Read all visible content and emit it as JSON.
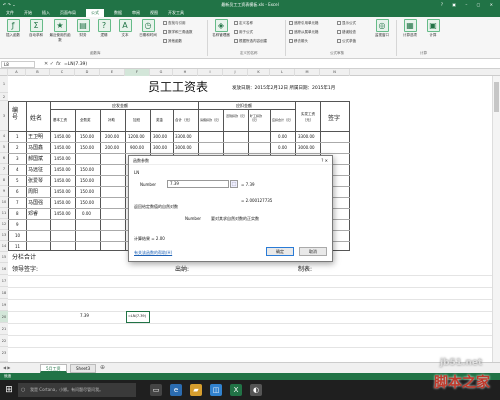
{
  "window": {
    "title": "最新员工工资表模板.xls - Excel",
    "quick_access": "↶ ↷ ⌄",
    "controls": "? ▣ – ▢ ✕"
  },
  "ribbon_tabs": [
    "文件",
    "开始",
    "插入",
    "页面布局",
    "公式",
    "数据",
    "审阅",
    "视图",
    "开发工具"
  ],
  "active_tab": "公式",
  "ribbon": {
    "insert_function": "插入函数",
    "autosum": "自动求和",
    "recent": "最近使用的函数",
    "financial": "财务",
    "logical": "逻辑",
    "text": "文本",
    "datetime": "日期和时间",
    "lookup": "查找与引用",
    "math": "数学和三角函数",
    "more": "其他函数",
    "name_manager": "名称管理器",
    "define_name": "定义名称",
    "use_in_formula": "用于公式",
    "create_from_sel": "根据所选内容创建",
    "trace_precedents": "追踪引用单元格",
    "trace_dependents": "追踪从属单元格",
    "remove_arrows": "移去箭头",
    "show_formulas": "显示公式",
    "error_check": "错误检查",
    "eval_formula": "公式求值",
    "watch": "监视窗口",
    "calc_options": "计算选项",
    "calc_now": "计算",
    "group_library": "函数库",
    "group_names": "定义的名称",
    "group_audit": "公式审核",
    "group_calc": "计算"
  },
  "formula_bar": {
    "name_box": "L8",
    "fx": "fx",
    "formula": "=LN(7.39)"
  },
  "columns": [
    "A",
    "B",
    "C",
    "D",
    "E",
    "F",
    "G",
    "H",
    "I",
    "J",
    "K",
    "L",
    "M",
    "N"
  ],
  "rows": [
    "1",
    "2",
    "3",
    "4",
    "5",
    "6",
    "7",
    "8",
    "9",
    "10",
    "11",
    "12",
    "13",
    "14",
    "15",
    "16",
    "17",
    "18",
    "19",
    "20",
    "21",
    "22",
    "23"
  ],
  "sheet": {
    "title": "员工工资表",
    "pay_date": "发放日期：2015年2月12日 所属日期：2015年1月",
    "hdr_no": "编号",
    "hdr_name": "姓名",
    "hdr_should": "应发金额",
    "hdr_deduct": "应扣金额",
    "hdr_base": "基本工资",
    "hdr_allow": "全勤奖",
    "hdr_sub": "补助",
    "hdr_ot": "加班",
    "hdr_bonus": "奖金",
    "hdr_total": "合计（元）",
    "hdr_ded1": "请假扣款（元）",
    "hdr_ded2": "迟到扣款（元）",
    "hdr_ded3": "旷工扣款（元）",
    "hdr_ded_total": "应扣合计（元）",
    "hdr_actual": "实发工资（元）",
    "hdr_sign": "签字",
    "employees": [
      {
        "no": "1",
        "name": "王卫明",
        "base": "1450.00",
        "allow": "150.00",
        "sub": "200.00",
        "ot": "1200.00",
        "bonus": "300.00",
        "total": "3300.00",
        "ded": "0.00",
        "actual": "3300.00"
      },
      {
        "no": "2",
        "name": "马国鑫",
        "base": "1450.00",
        "allow": "150.00",
        "sub": "200.00",
        "ot": "900.00",
        "bonus": "300.00",
        "total": "3000.00",
        "ded": "0.00",
        "actual": "3000.00"
      },
      {
        "no": "3",
        "name": "郝国斌",
        "base": "1450.00",
        "allow": "",
        "sub": "",
        "ot": "",
        "bonus": "",
        "total": "",
        "ded": "",
        "actual": ""
      },
      {
        "no": "4",
        "name": "马远征",
        "base": "1450.00",
        "allow": "150.00",
        "sub": "",
        "ot": "",
        "bonus": "",
        "total": "",
        "ded": "",
        "actual": ""
      },
      {
        "no": "5",
        "name": "张爱琴",
        "base": "1450.00",
        "allow": "150.00",
        "sub": "",
        "ot": "",
        "bonus": "",
        "total": "",
        "ded": "",
        "actual": ""
      },
      {
        "no": "6",
        "name": "周阳",
        "base": "1450.00",
        "allow": "150.00",
        "sub": "",
        "ot": "",
        "bonus": "",
        "total": "",
        "ded": "",
        "actual": ""
      },
      {
        "no": "7",
        "name": "马国强",
        "base": "1450.00",
        "allow": "150.00",
        "sub": "",
        "ot": "",
        "bonus": "",
        "total": "",
        "ded": "",
        "actual": ""
      },
      {
        "no": "8",
        "name": "邓睿",
        "base": "1450.00",
        "allow": "0.00",
        "sub": "",
        "ot": "",
        "bonus": "",
        "total": "",
        "ded": "",
        "actual": ""
      }
    ],
    "empty_rows": [
      "9",
      "10",
      "11"
    ],
    "subtotal": "分栏合计",
    "leader_sign": "领导签字:",
    "cashier": "出纳:",
    "accountant": "制表:",
    "cell_value": "7.39",
    "active_cell_formula": "=LN(7.39)"
  },
  "dialog": {
    "title": "函数参数",
    "func": "LN",
    "arg_label": "Number",
    "arg_value": "7.39",
    "arg_result": "= 7.39",
    "result_line": "= 2.000127735",
    "description": "返回给定数值的自然对数",
    "arg_desc_label": "Number",
    "arg_desc": "要对其求自然对数的正实数",
    "calc_result": "计算结果 = 2.00",
    "help_link": "有关该函数的帮助(H)",
    "ok": "确定",
    "cancel": "取消"
  },
  "sheet_tabs": [
    "5月工资",
    "Sheet3"
  ],
  "active_sheet": "5月工资",
  "status": "就绪",
  "taskbar": {
    "search": "我是 Cortana，小娜。有问题尽管问我。"
  },
  "watermark": {
    "site": "jb51.net",
    "name": "脚本之家"
  }
}
